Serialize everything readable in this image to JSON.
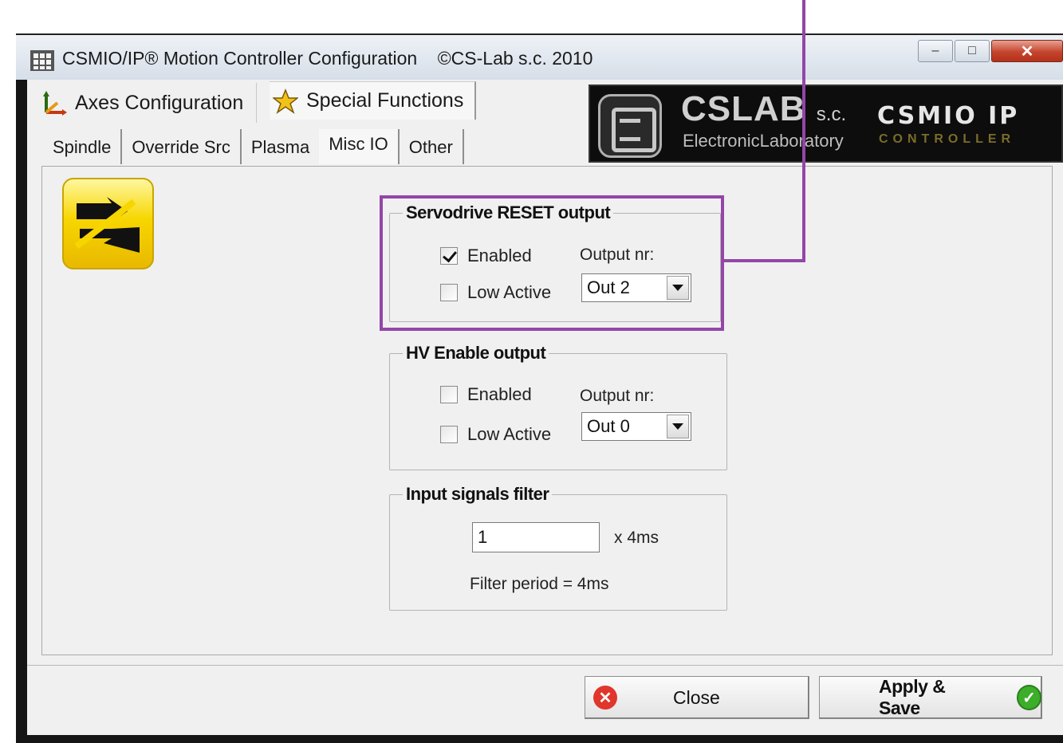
{
  "window": {
    "title": "CSMIO/IP® Motion Controller Configuration    ©CS-Lab s.c. 2010",
    "minimize_icon": "minimize-icon",
    "maximize_icon": "maximize-icon",
    "close_icon": "close-icon"
  },
  "main_tabs": [
    {
      "label": "Axes Configuration",
      "icon": "axes-icon"
    },
    {
      "label": "Special Functions",
      "icon": "star-icon",
      "active": true
    }
  ],
  "sub_tabs": [
    {
      "label": "Spindle"
    },
    {
      "label": "Override Src"
    },
    {
      "label": "Plasma"
    },
    {
      "label": "Misc IO",
      "active": true
    },
    {
      "label": "Other"
    }
  ],
  "banner": {
    "title": "CSLAB",
    "title_suffix": "s.c.",
    "subtitle": "ElectronicLaboratory",
    "brand": "CSMIO IP",
    "brand_sub": "CONTROLLER"
  },
  "servodrive_reset": {
    "title": "Servodrive RESET output",
    "enabled_label": "Enabled",
    "enabled": true,
    "low_active_label": "Low Active",
    "low_active": false,
    "output_label": "Output nr:",
    "output_value": "Out 2"
  },
  "hv_enable": {
    "title": "HV Enable output",
    "enabled_label": "Enabled",
    "enabled": false,
    "low_active_label": "Low Active",
    "low_active": false,
    "output_label": "Output nr:",
    "output_value": "Out 0"
  },
  "input_filter": {
    "title": "Input signals filter",
    "value": "1",
    "unit": "x 4ms",
    "period_text": "Filter period = 4ms"
  },
  "buttons": {
    "close_label": "Close",
    "apply_label": "Apply & Save"
  },
  "colors": {
    "highlight": "#9346a8",
    "close_icon_red": "#e0362c",
    "ok_icon_green": "#3cae2a"
  }
}
